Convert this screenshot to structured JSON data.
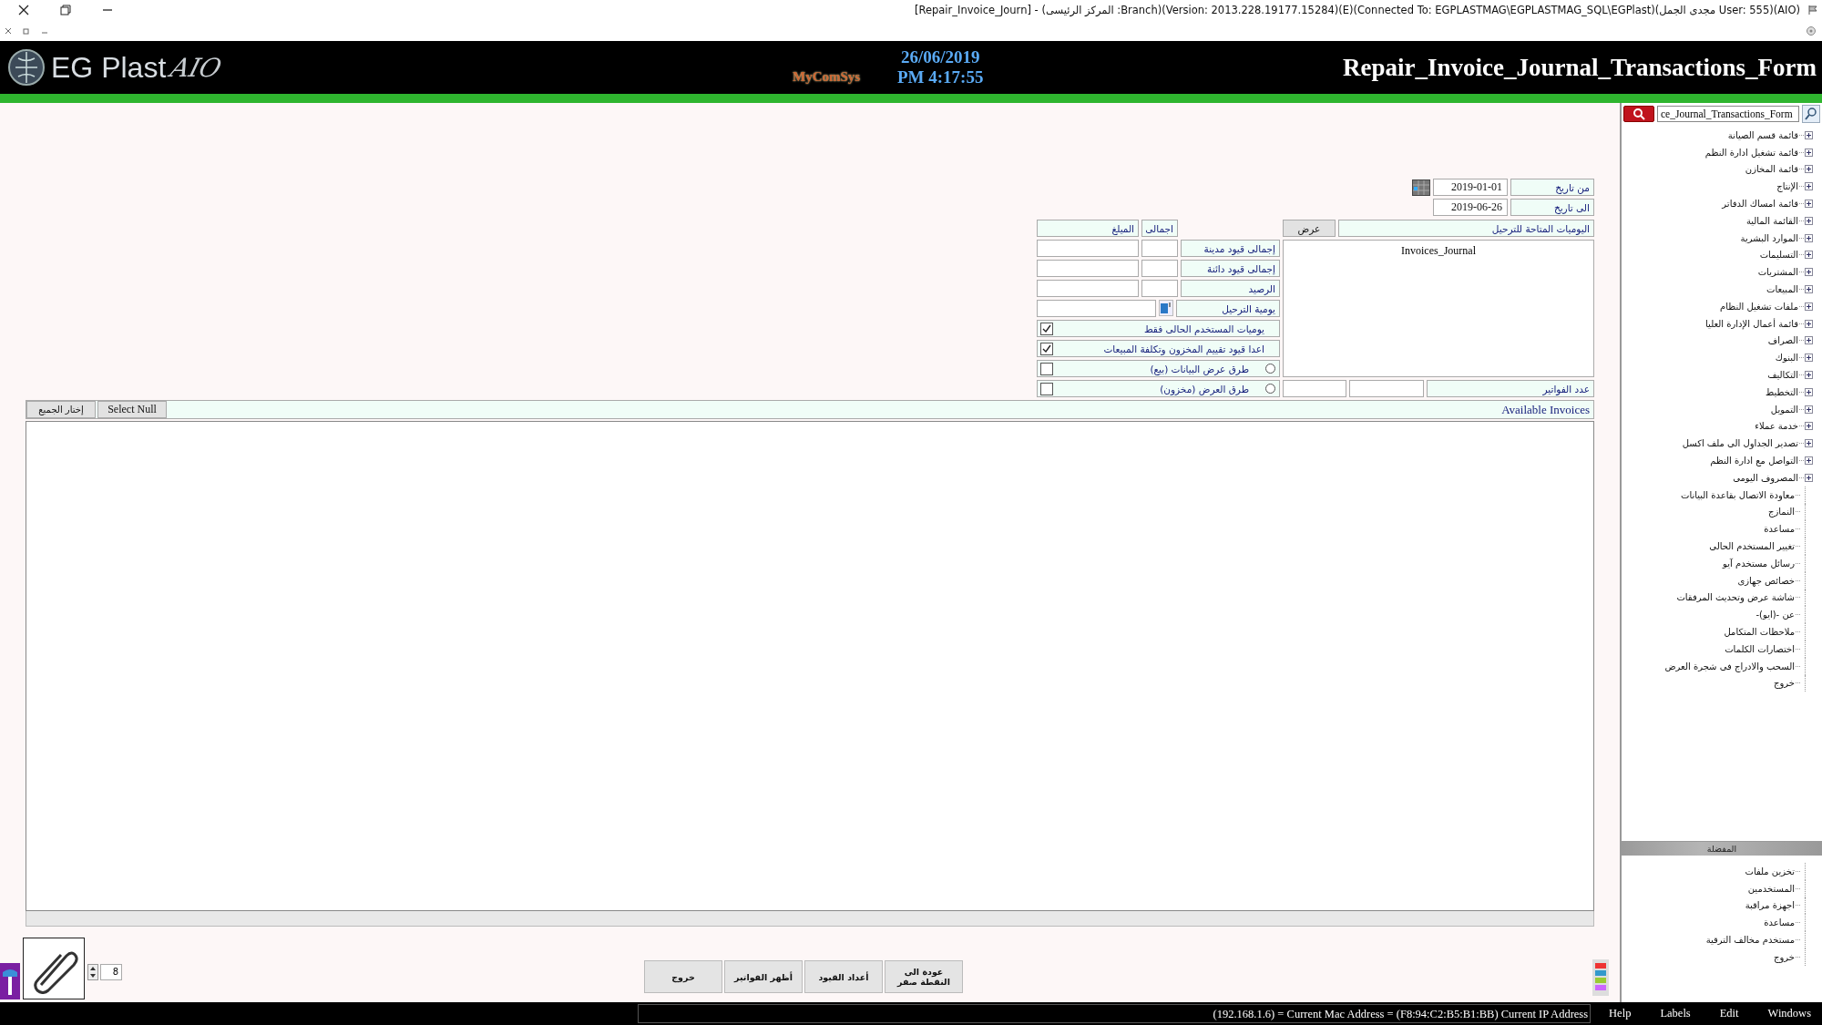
{
  "window": {
    "title": "[Repair_Invoice_Journ] - (المركز الرئيسى :Branch)(Version: 2013.228.19177.15284)(E)(Connected To: EGPLASTMAG\\EGPLASTMAG_SQL\\EGPlast)(مجدى الجمل User: 555)(AIO)"
  },
  "header": {
    "logo": "EG Plast",
    "logo_suffix": "AIO",
    "vendor": "MyComSys",
    "date": "26/06/2019",
    "time": "PM 4:17:55",
    "form_title": "Repair_Invoice_Journal_Transactions_Form"
  },
  "dates": [
    {
      "label": "من تاريخ",
      "value": "2019-01-01",
      "calendar": true
    },
    {
      "label": "الى تاريخ",
      "value": "2019-06-26",
      "calendar": false
    }
  ],
  "summary": {
    "headers": [
      "اجمالى",
      "الميلغ"
    ],
    "rows": [
      {
        "label": "إجمالى قيود مدينة"
      },
      {
        "label": "إجمالى قيود دائنة"
      },
      {
        "label": "الرصيد"
      }
    ],
    "journal_label": "يومية الترحيل"
  },
  "options": [
    {
      "kind": "checkbox",
      "label": "يوميات المستخدم الحالى فقط",
      "checked": true
    },
    {
      "kind": "checkbox",
      "label": "اعدا قيود تقييم المخزون وتكلفة المبيعات",
      "checked": true
    },
    {
      "kind": "radio",
      "label": "طرق عرض البيانات (بيع)",
      "checked": false,
      "selected": false
    },
    {
      "kind": "radio",
      "label": "طرق العرض (مخزون)",
      "checked": false,
      "selected": false
    }
  ],
  "journals": {
    "label": "اليوميات المتاحة للترحيل",
    "button": "عرض",
    "items": [
      "Invoices_Journal"
    ],
    "count_label": "عدد الفواتير"
  },
  "invoices": {
    "title": "Available Invoices",
    "buttons": [
      "Select Null",
      "إختار الجميع"
    ]
  },
  "spinner": {
    "value": "8"
  },
  "actions": [
    "عودة الى النقطة صفر",
    "أعداد القيود",
    "أظهر الفواتير",
    "خروج"
  ],
  "sidebar": {
    "search": {
      "value": "ce_Journal_Transactions_Form"
    },
    "items": [
      {
        "kind": "group",
        "label": "قائمة قسم الصيانة"
      },
      {
        "kind": "group",
        "label": "قائمة تشغيل ادارة النظم"
      },
      {
        "kind": "group",
        "label": "قائمة المخازن"
      },
      {
        "kind": "group",
        "label": "الإنتاج"
      },
      {
        "kind": "group",
        "label": "قائمة امساك الدفاتر"
      },
      {
        "kind": "group",
        "label": "القائمة المالية"
      },
      {
        "kind": "group",
        "label": "الموارد البشرية"
      },
      {
        "kind": "group",
        "label": "التسليمات"
      },
      {
        "kind": "group",
        "label": "المشتريات"
      },
      {
        "kind": "group",
        "label": "المبيعات"
      },
      {
        "kind": "group",
        "label": "ملفات تشغيل النظام"
      },
      {
        "kind": "group",
        "label": "قائمة أعمال الإدارة العليا"
      },
      {
        "kind": "group",
        "label": "الصراف"
      },
      {
        "kind": "group",
        "label": "البنوك"
      },
      {
        "kind": "group",
        "label": "التكاليف"
      },
      {
        "kind": "group",
        "label": "التخطيط"
      },
      {
        "kind": "group",
        "label": "التمويل"
      },
      {
        "kind": "group",
        "label": "خدمة عملاء"
      },
      {
        "kind": "group",
        "label": "تصدير الجداول الى ملف اكسل"
      },
      {
        "kind": "group",
        "label": "التواصل مع ادارة النظم"
      },
      {
        "kind": "group",
        "label": "المصروف اليومى"
      },
      {
        "kind": "leaf",
        "label": "معاودة الاتصال بقاعدة البيانات"
      },
      {
        "kind": "leaf",
        "label": "النمازج"
      },
      {
        "kind": "leaf",
        "label": "مساعدة"
      },
      {
        "kind": "leaf",
        "label": "تغيير المستخدم الحالى"
      },
      {
        "kind": "leaf",
        "label": "رسائل مستخدم آيو"
      },
      {
        "kind": "leaf",
        "label": "خصائص جهازى"
      },
      {
        "kind": "leaf",
        "label": "شاشة عرض وتحديث المرفقات"
      },
      {
        "kind": "leaf",
        "label": "عن -(ايو)-"
      },
      {
        "kind": "leaf",
        "label": "ملاحظات المتكامل"
      },
      {
        "kind": "leaf",
        "label": "اختصارات الكلمات"
      },
      {
        "kind": "leaf",
        "label": "السحب والادراج فى شجرة العرض"
      },
      {
        "kind": "leaf",
        "label": "خروج"
      }
    ],
    "favorites": {
      "title": "المفضلة",
      "items": [
        "تخزين ملفات",
        "المستخدمين",
        "اجهزة مراقبة",
        "مساعدة",
        "مستخدم مخالف الترقية",
        "خروج"
      ]
    }
  },
  "status_bar": {
    "text": "(192.168.1.6) = Current Mac Address = (F8:94:C2:B5:B1:BB) Current IP Address",
    "menu": [
      "Windows",
      "Edit",
      "Labels",
      "Help"
    ]
  }
}
